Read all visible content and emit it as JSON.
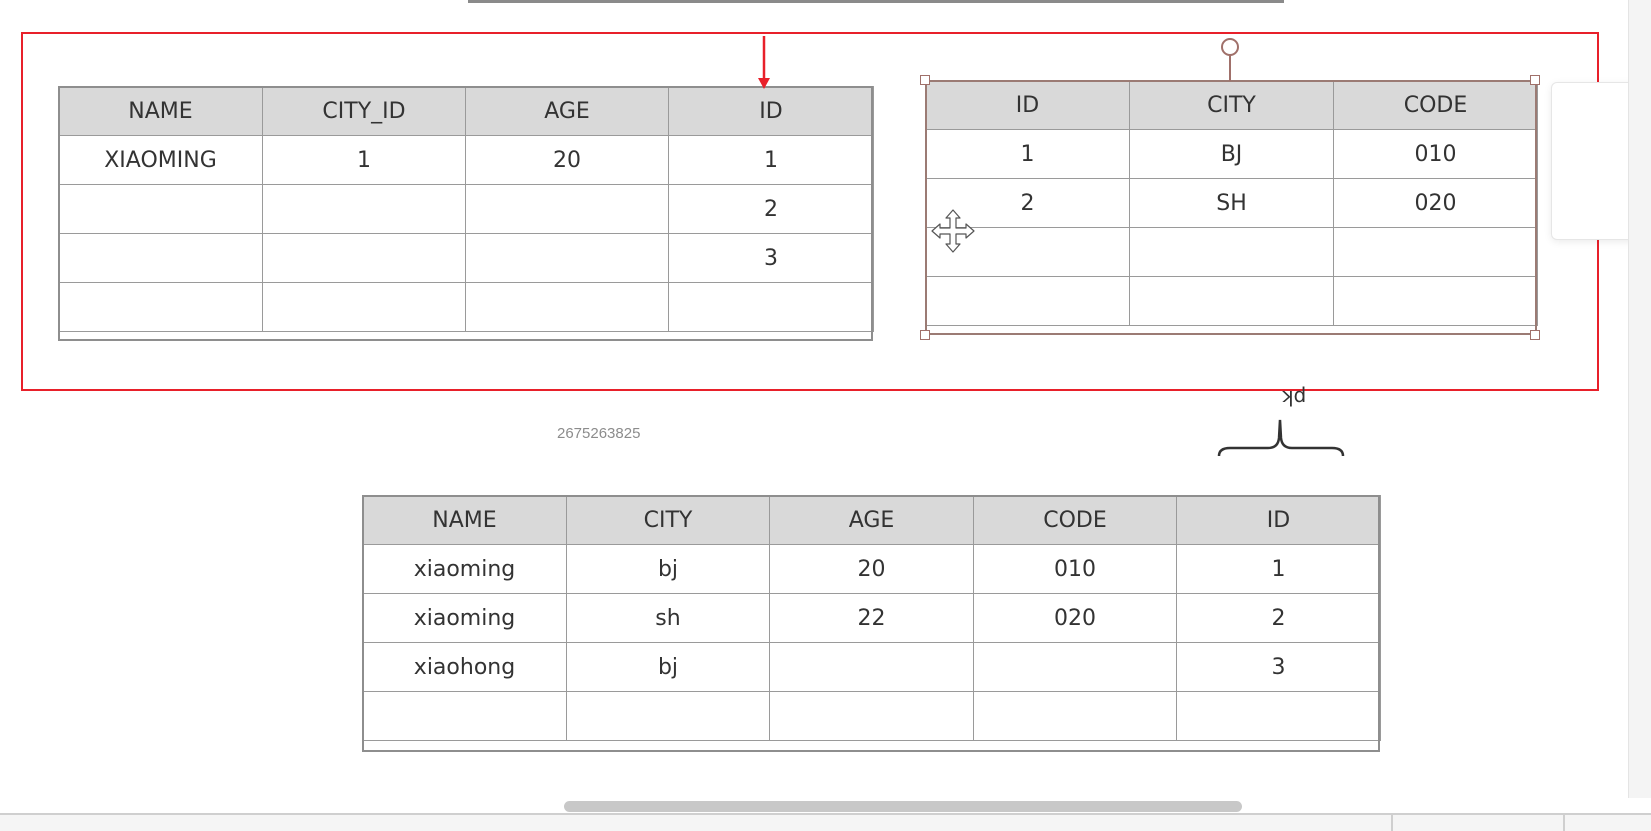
{
  "table_a": {
    "headers": [
      "NAME",
      "CITY_ID",
      "AGE",
      "ID"
    ],
    "rows": [
      [
        "XIAOMING",
        "1",
        "20",
        "1"
      ],
      [
        "",
        "",
        "",
        "2"
      ],
      [
        "",
        "",
        "",
        "3"
      ],
      [
        "",
        "",
        "",
        ""
      ]
    ]
  },
  "table_b": {
    "headers": [
      "ID",
      "CITY",
      "CODE"
    ],
    "rows": [
      [
        "1",
        "BJ",
        "010"
      ],
      [
        "2",
        "SH",
        "020"
      ],
      [
        "",
        "",
        ""
      ],
      [
        "",
        "",
        ""
      ]
    ]
  },
  "table_c": {
    "headers": [
      "NAME",
      "CITY",
      "AGE",
      "CODE",
      "ID"
    ],
    "rows": [
      [
        "xiaoming",
        "bj",
        "20",
        "010",
        "1"
      ],
      [
        "xiaoming",
        "sh",
        "22",
        "020",
        "2"
      ],
      [
        "xiaohong",
        "bj",
        "",
        "",
        "3"
      ],
      [
        "",
        "",
        "",
        "",
        ""
      ]
    ]
  },
  "annotations": {
    "id_number": "2675263825",
    "pk": "pk"
  },
  "colors": {
    "selection_border": "#e8202a",
    "header_fill": "#d9d9d9",
    "handle_stroke": "#a0706a"
  },
  "icons": {
    "move_cursor": "move-cursor-icon",
    "rotate_handle": "rotate-handle-icon",
    "connector_arrow": "arrow-down-icon"
  }
}
